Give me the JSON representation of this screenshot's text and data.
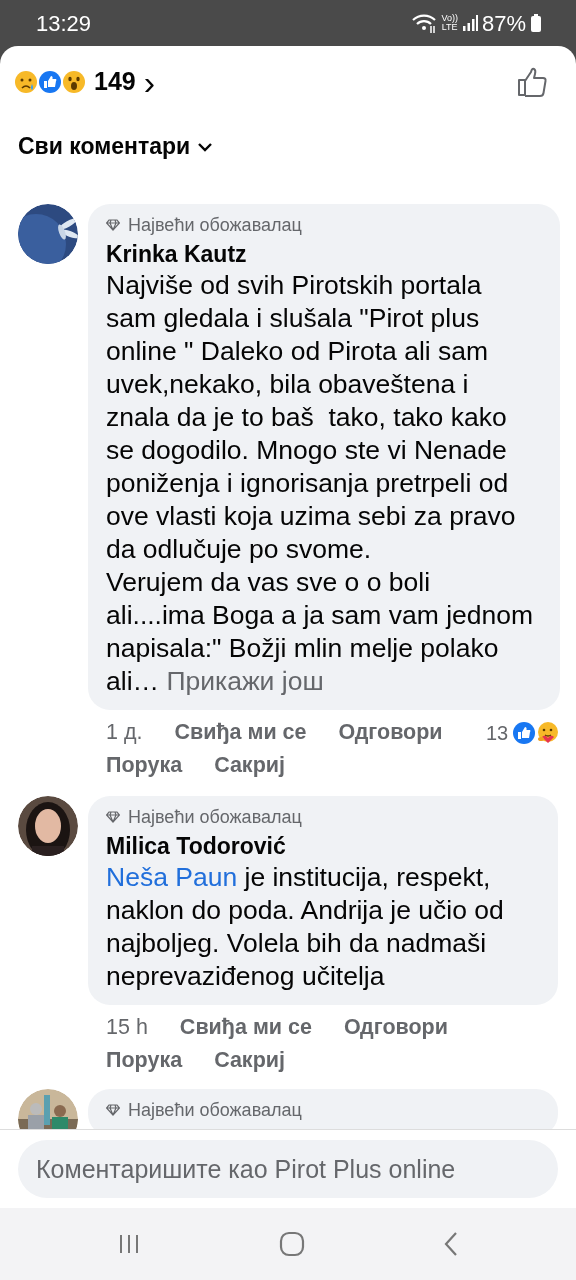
{
  "status_bar": {
    "time": "13:29",
    "network_top": "Vo))",
    "network_bottom": "LTE",
    "battery": "87%"
  },
  "reactions_summary": {
    "count": "149",
    "chevron": "›"
  },
  "filter": {
    "label": "Сви коментари"
  },
  "comments": [
    {
      "badge": "Највећи обожавалац",
      "author": "Krinka Kautz",
      "body": [
        {
          "kind": "text",
          "text": "Najviše od svih Pirotskih portala sam gledala i slušala \"Pirot plus online \" Daleko od Pirota ali sam uvek,nekako, bila obaveštena i znala da je to baš  tako, tako kako se dogodilo. Mnogo ste vi Nenade poniženja i ignorisanja pretrpeli od ove vlasti koja uzima sebi za pravo da odlučuje po svome.\nVerujem da vas sve o o boli ali....ima Boga a ja sam vam jednom napisala:\" Božji mlin melje polako ali… "
        },
        {
          "kind": "more",
          "text": "Прикажи још"
        }
      ],
      "time": "1 д.",
      "actions": [
        "Свиђа ми се",
        "Одговори",
        "Порука",
        "Сакриј"
      ],
      "reaction_count": "13"
    },
    {
      "badge": "Највећи обожавалац",
      "author": "Milica Todorović",
      "body": [
        {
          "kind": "mention",
          "text": "Neša Paun"
        },
        {
          "kind": "text",
          "text": " je institucija, respekt, naklon do poda. Andrija je učio od najboljeg. Volela bih da nadmaši neprevaziđenog učitelja"
        }
      ],
      "time": "15 h",
      "actions": [
        "Свиђа ми се",
        "Одговори",
        "Порука",
        "Сакриј"
      ]
    },
    {
      "badge": "Највећи обожавалац"
    }
  ],
  "composer": {
    "placeholder": "Коментаришите као Pirot Plus online"
  }
}
